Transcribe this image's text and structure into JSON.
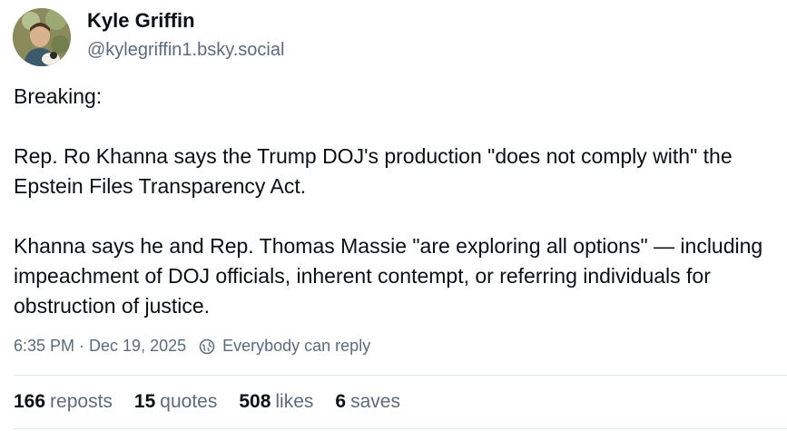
{
  "author": {
    "name": "Kyle Griffin",
    "handle": "@kylegriffin1.bsky.social"
  },
  "post": {
    "paragraphs": [
      "Breaking:",
      "Rep. Ro Khanna says the Trump DOJ's production \"does not comply with\" the Epstein Files Transparency Act.",
      "Khanna says he and Rep. Thomas Massie \"are exploring all options\" — including impeachment of DOJ officials, inherent contempt, or referring individuals for obstruction of justice."
    ],
    "timestamp": "6:35 PM · Dec 19, 2025",
    "reply_setting": "Everybody can reply",
    "reply_icon": "globe-reply-icon"
  },
  "stats": {
    "reposts": {
      "count": "166",
      "label": "reposts"
    },
    "quotes": {
      "count": "15",
      "label": "quotes"
    },
    "likes": {
      "count": "508",
      "label": "likes"
    },
    "saves": {
      "count": "6",
      "label": "saves"
    }
  },
  "colors": {
    "text": "#0b0f14",
    "secondary": "#5a6b7d",
    "divider": "#dfe5ec"
  }
}
